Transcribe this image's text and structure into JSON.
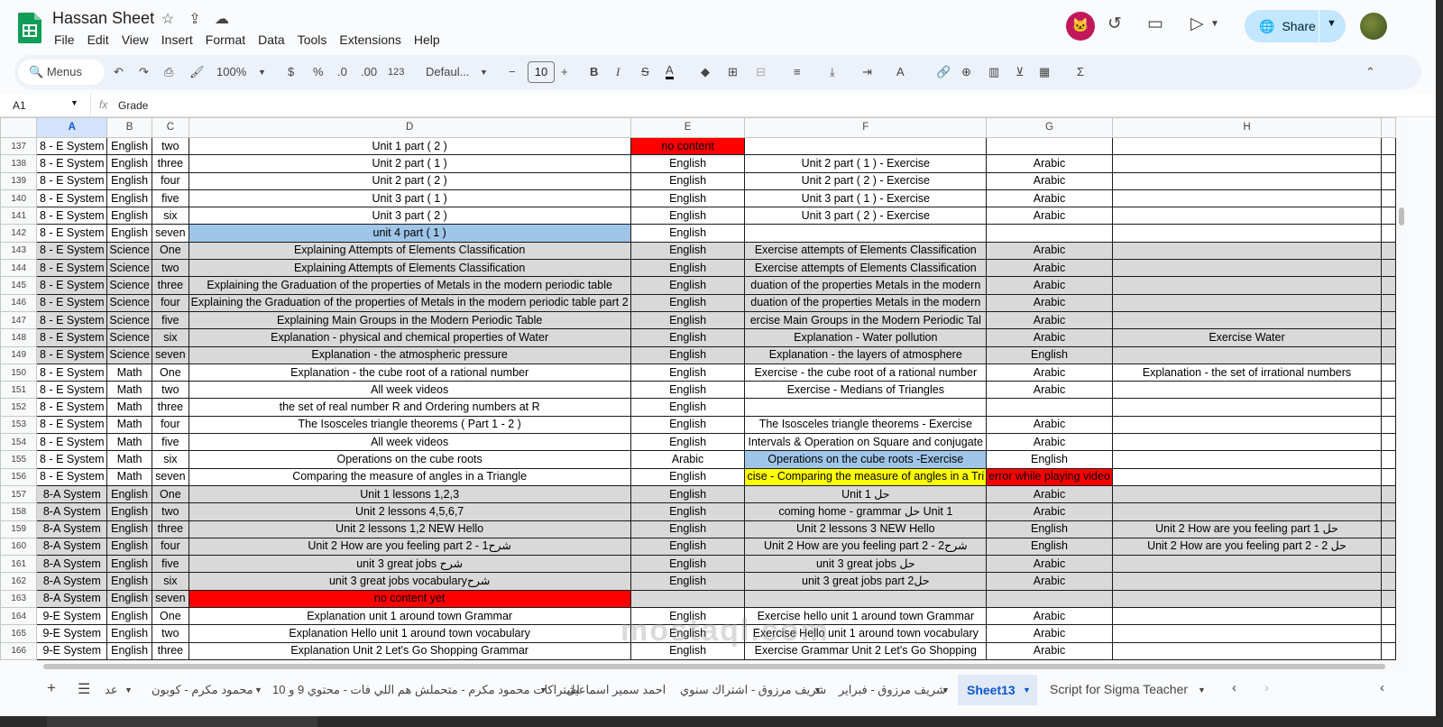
{
  "app": {
    "title": "Hassan Sheet"
  },
  "menu": [
    "File",
    "Edit",
    "View",
    "Insert",
    "Format",
    "Data",
    "Tools",
    "Extensions",
    "Help"
  ],
  "share_label": "Share",
  "toolbar": {
    "search": "Menus",
    "zoom": "100%",
    "currency": "$",
    "percent": "%",
    "dec_minus": ".0",
    "dec_plus": ".00",
    "numfmt": "123",
    "font": "Defaul...",
    "font_size": "10"
  },
  "formula_bar": {
    "cell_ref": "A1",
    "fx": "fx",
    "value": "Grade"
  },
  "columns": [
    "A",
    "B",
    "C",
    "D",
    "E",
    "F",
    "G",
    "H"
  ],
  "rows": [
    {
      "n": "137",
      "gray": false,
      "c": [
        "8 - E System",
        "English",
        "two",
        "Unit 1 part ( 2 )",
        "no content",
        "",
        "",
        ""
      ],
      "hl": {
        "4": "red"
      }
    },
    {
      "n": "138",
      "gray": false,
      "c": [
        "8 - E System",
        "English",
        "three",
        "Unit 2 part ( 1 )",
        "English",
        "Unit 2 part ( 1 ) - Exercise",
        "Arabic",
        ""
      ]
    },
    {
      "n": "139",
      "gray": false,
      "c": [
        "8 - E System",
        "English",
        "four",
        "Unit 2 part ( 2 )",
        "English",
        "Unit 2 part ( 2 ) - Exercise",
        "Arabic",
        ""
      ]
    },
    {
      "n": "140",
      "gray": false,
      "c": [
        "8 - E System",
        "English",
        "five",
        "Unit 3  part ( 1 )",
        "English",
        "Unit 3 part ( 1 )  - Exercise",
        "Arabic",
        ""
      ]
    },
    {
      "n": "141",
      "gray": false,
      "c": [
        "8 - E System",
        "English",
        "six",
        "Unit 3  part ( 2 )",
        "English",
        "Unit 3  part ( 2 ) - Exercise",
        "Arabic",
        ""
      ]
    },
    {
      "n": "142",
      "gray": false,
      "c": [
        "8 - E System",
        "English",
        "seven",
        "unit 4 part ( 1 )",
        "English",
        "",
        "",
        ""
      ],
      "hl": {
        "3": "blue"
      }
    },
    {
      "n": "143",
      "gray": true,
      "c": [
        "8 - E System",
        "Science",
        "One",
        "Explaining Attempts of Elements Classification",
        "English",
        "Exercise  attempts of Elements Classification",
        "Arabic",
        ""
      ]
    },
    {
      "n": "144",
      "gray": true,
      "c": [
        "8 - E System",
        "Science",
        "two",
        "Explaining Attempts of Elements Classification",
        "English",
        "Exercise  attempts of Elements Classification",
        "Arabic",
        ""
      ]
    },
    {
      "n": "145",
      "gray": true,
      "c": [
        "8 - E System",
        "Science",
        "three",
        "Explaining the Graduation of the properties of Metals in the modern periodic table",
        "English",
        "duation of the properties Metals in the modern",
        "Arabic",
        ""
      ]
    },
    {
      "n": "146",
      "gray": true,
      "c": [
        "8 - E System",
        "Science",
        "four",
        "Explaining the Graduation of the properties of Metals in the modern periodic table part 2",
        "English",
        "duation of the properties Metals in the modern",
        "Arabic",
        ""
      ]
    },
    {
      "n": "147",
      "gray": true,
      "c": [
        "8 - E System",
        "Science",
        "five",
        "Explaining Main Groups in the Modern Periodic Table",
        "English",
        "ercise  Main Groups in the Modern Periodic Tal",
        "Arabic",
        ""
      ]
    },
    {
      "n": "148",
      "gray": true,
      "c": [
        "8 - E System",
        "Science",
        "six",
        "Explanation  - physical and chemical properties of Water",
        "English",
        "Explanation - Water pollution",
        "Arabic",
        "Exercise Water"
      ]
    },
    {
      "n": "149",
      "gray": true,
      "c": [
        "8 - E System",
        "Science",
        "seven",
        "Explanation  - the atmospheric pressure",
        "English",
        "Explanation - the layers of atmosphere",
        "English",
        ""
      ]
    },
    {
      "n": "150",
      "gray": false,
      "c": [
        "8 - E System",
        "Math",
        "One",
        "Explanation - the cube root of a rational number",
        "English",
        "Exercise - the cube root of a rational number",
        "Arabic",
        "Explanation - the set of irrational numbers"
      ]
    },
    {
      "n": "151",
      "gray": false,
      "c": [
        "8 - E System",
        "Math",
        "two",
        "All week videos",
        "English",
        "Exercise - Medians of Triangles",
        "Arabic",
        ""
      ]
    },
    {
      "n": "152",
      "gray": false,
      "c": [
        "8 - E System",
        "Math",
        "three",
        "the set of real number R and Ordering numbers at R",
        "English",
        "",
        "",
        ""
      ]
    },
    {
      "n": "153",
      "gray": false,
      "c": [
        "8 - E System",
        "Math",
        "four",
        "The Isosceles triangle theorems ( Part 1 - 2 )",
        "English",
        "The Isosceles triangle theorems - Exercise",
        "Arabic",
        ""
      ]
    },
    {
      "n": "154",
      "gray": false,
      "c": [
        "8 - E System",
        "Math",
        "five",
        "All week videos",
        "English",
        "Intervals & Operation on Square and conjugate",
        "Arabic",
        ""
      ]
    },
    {
      "n": "155",
      "gray": false,
      "c": [
        "8 - E System",
        "Math",
        "six",
        "Operations on the cube roots",
        "Arabic",
        "Operations on the cube roots -Exercise",
        "English",
        ""
      ],
      "hl": {
        "5": "blue"
      }
    },
    {
      "n": "156",
      "gray": false,
      "c": [
        "8 - E System",
        "Math",
        "seven",
        "Comparing the measure of angles in a Triangle",
        "English",
        "cise - Comparing the measure of angles in a Tri",
        "error while playing video",
        ""
      ],
      "hl": {
        "5": "yellow",
        "6": "red"
      }
    },
    {
      "n": "157",
      "gray": true,
      "c": [
        "8-A  System",
        "English",
        "One",
        "Unit 1 lessons 1,2,3",
        "English",
        "Unit 1 حل",
        "Arabic",
        ""
      ]
    },
    {
      "n": "158",
      "gray": true,
      "c": [
        "8-A  System",
        "English",
        "two",
        "Unit 2 lessons 4,5,6,7",
        "English",
        "coming home - grammar حل  Unit 1",
        "Arabic",
        ""
      ]
    },
    {
      "n": "159",
      "gray": true,
      "c": [
        "8-A  System",
        "English",
        "three",
        "Unit 2 lessons 1,2 NEW Hello",
        "English",
        "Unit 2 lessons 3 NEW Hello",
        "English",
        "Unit 2 How are you feeling part 1 حل"
      ]
    },
    {
      "n": "160",
      "gray": true,
      "c": [
        "8-A  System",
        "English",
        "four",
        "Unit 2 How are you feeling part 2 - شرح1",
        "English",
        "Unit 2 How are you feeling part 2 - شرح2",
        "English",
        "Unit 2 How are you feeling part 2 - 2 حل"
      ]
    },
    {
      "n": "161",
      "gray": true,
      "c": [
        "8-A  System",
        "English",
        "five",
        "unit 3 great jobs شرح",
        "English",
        "unit 3 great jobs حل",
        "Arabic",
        ""
      ]
    },
    {
      "n": "162",
      "gray": true,
      "c": [
        "8-A  System",
        "English",
        "six",
        "unit 3 great jobs  vocabularyشرح",
        "English",
        "unit 3 great jobs   part 2حل",
        "Arabic",
        ""
      ]
    },
    {
      "n": "163",
      "gray": true,
      "c": [
        "8-A  System",
        "English",
        "seven",
        "no content yet",
        "",
        "",
        "",
        ""
      ],
      "hl": {
        "3": "red"
      }
    },
    {
      "n": "164",
      "gray": false,
      "c": [
        "9-E System",
        "English",
        "One",
        "Explanation unit 1 around town Grammar",
        "English",
        "Exercise hello unit 1 around town Grammar",
        "Arabic",
        ""
      ]
    },
    {
      "n": "165",
      "gray": false,
      "c": [
        "9-E System",
        "English",
        "two",
        "Explanation Hello unit 1 around town vocabulary",
        "English",
        "Exercise Hello unit 1 around town vocabulary",
        "Arabic",
        ""
      ]
    },
    {
      "n": "166",
      "gray": false,
      "c": [
        "9-E System",
        "English",
        "three",
        "Explanation Unit 2 Let's Go Shopping Grammar",
        "English",
        "Exercise Grammar Unit 2 Let's Go Shopping",
        "Arabic",
        ""
      ]
    }
  ],
  "sheets": [
    "عد",
    "محمود مكرم - كوبون",
    "اشتراكات محمود مكرم - متحملش هم اللي فات - محتوي 9 و 10",
    "احمد سمير اسماعيل",
    "شريف مرزوق - اشتراك سنوي",
    "شريف مرزوق - فبراير",
    "Sheet13",
    "Script for Sigma Teacher"
  ],
  "watermark": "mostaql.com"
}
